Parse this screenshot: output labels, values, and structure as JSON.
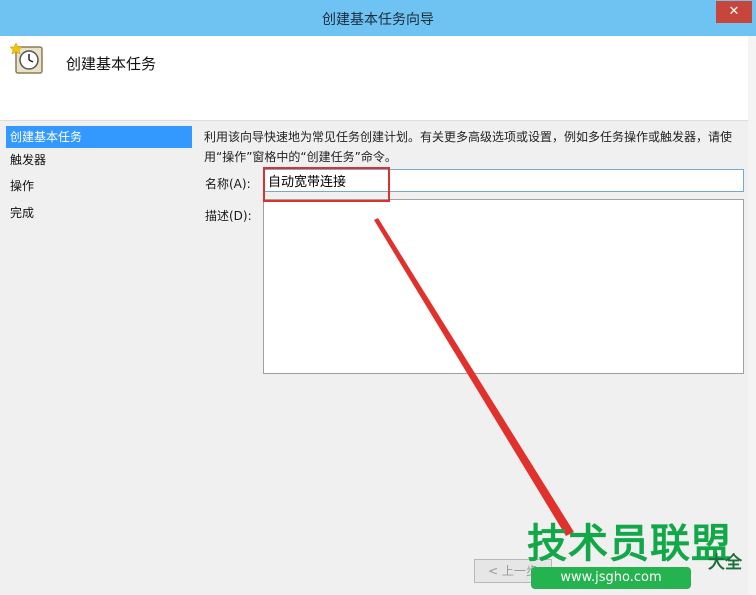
{
  "window": {
    "title": "创建基本任务向导",
    "close_glyph": "✕"
  },
  "header": {
    "title": "创建基本任务",
    "icon": "task-scheduler-clock-icon"
  },
  "sidebar": {
    "items": [
      {
        "label": "创建基本任务",
        "active": true
      },
      {
        "label": "触发器",
        "active": false
      },
      {
        "label": "操作",
        "active": false
      },
      {
        "label": "完成",
        "active": false
      }
    ]
  },
  "main": {
    "description": "利用该向导快速地为常见任务创建计划。有关更多高级选项或设置，例如多任务操作或触发器，请使用“操作”窗格中的“创建任务”命令。",
    "name_label": "名称(A):",
    "name_value": "自动宽带连接",
    "desc_label": "描述(D):",
    "desc_value": ""
  },
  "footer": {
    "back_label": "< 上一步"
  },
  "watermark": {
    "text": "技术员联盟",
    "url": "www.jsgho.com",
    "side": "大全"
  },
  "colors": {
    "titlebar": "#6fc3f3",
    "active_step": "#3399ff",
    "highlight": "#d9322f",
    "arrow": "#e0312c"
  }
}
